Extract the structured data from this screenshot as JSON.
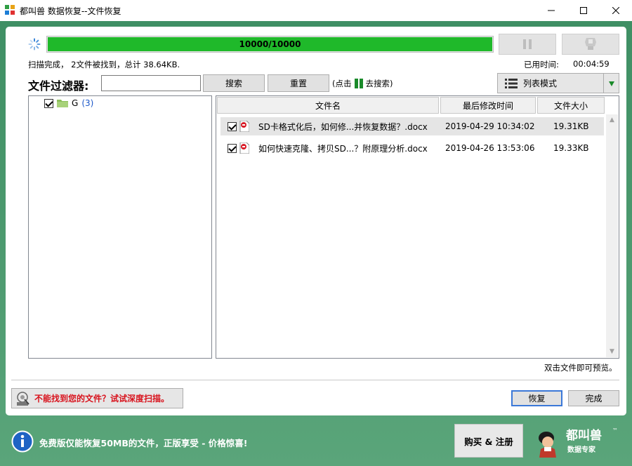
{
  "window": {
    "title": "都叫兽 数据恢复--文件恢复"
  },
  "scan": {
    "progress_text": "10000/10000",
    "progress_fraction": 1.0,
    "status": "扫描完成， 2文件被找到，总计 38.64KB.",
    "elapsed_label": "已用时间:",
    "elapsed_value": "00:04:59"
  },
  "filter": {
    "label": "文件过滤器:",
    "input_value": "",
    "search_label": "搜索",
    "reset_label": "重置",
    "hint_before": "(点击",
    "hint_after": "去搜索)"
  },
  "view_mode": {
    "selected": "列表模式"
  },
  "tree": {
    "items": [
      {
        "label": "G",
        "count": "(3)",
        "checked": true
      }
    ]
  },
  "list": {
    "columns": [
      "文件名",
      "最后修改时间",
      "文件大小"
    ],
    "rows": [
      {
        "name": "SD卡格式化后，如何修...并恢复数据？.docx",
        "date": "2019-04-29 10:34:02",
        "size": "19.31KB",
        "checked": true,
        "selected": true
      },
      {
        "name": "如何快速克隆、拷贝SD...？附原理分析.docx",
        "date": "2019-04-26 13:53:06",
        "size": "19.33KB",
        "checked": true,
        "selected": false
      }
    ]
  },
  "preview_hint": "双击文件即可预览。",
  "actions": {
    "deep_scan_label": "不能找到您的文件？试试深度扫描。",
    "recover_label": "恢复",
    "finish_label": "完成"
  },
  "footer": {
    "notice": "免费版仅能恢复50MB的文件，正版享受 - 价格惊喜!",
    "buy_label": "购买 & 注册",
    "logo_text": "都叫兽",
    "logo_subtext": "数据专家",
    "logo_tm": "™"
  },
  "colors": {
    "progress_fill": "#1fb92a",
    "frame_green": "#4e9a6e",
    "deep_scan_text": "#d8121c",
    "tree_count": "#1a56c8"
  }
}
